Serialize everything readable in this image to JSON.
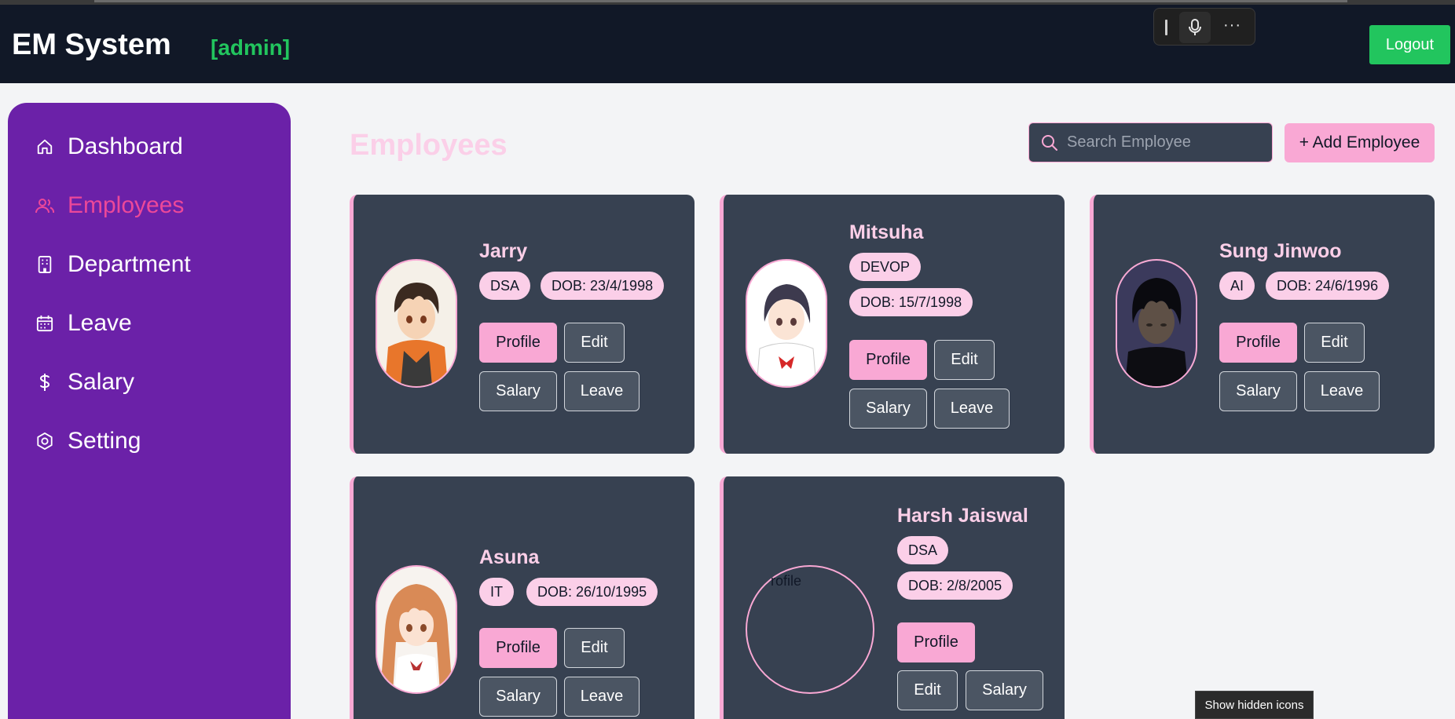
{
  "header": {
    "brand": "EM System",
    "role": "[admin]",
    "logout_label": "Logout"
  },
  "voice_toolbar": {
    "icons": [
      "text-cursor-icon",
      "microphone-icon",
      "more-icon"
    ],
    "more_glyph": "···"
  },
  "sidebar": {
    "items": [
      {
        "label": "Dashboard",
        "icon": "home-icon",
        "active": false
      },
      {
        "label": "Employees",
        "icon": "users-icon",
        "active": true
      },
      {
        "label": "Department",
        "icon": "building-icon",
        "active": false
      },
      {
        "label": "Leave",
        "icon": "calendar-icon",
        "active": false
      },
      {
        "label": "Salary",
        "icon": "dollar-icon",
        "active": false
      },
      {
        "label": "Setting",
        "icon": "settings-icon",
        "active": false
      }
    ]
  },
  "main": {
    "title": "Employees",
    "search_placeholder": "Search Employee",
    "add_label": "+ Add Employee"
  },
  "employees": [
    {
      "name": "Jarry",
      "department": "DSA",
      "dob": "DOB: 23/4/1998"
    },
    {
      "name": "Mitsuha",
      "department": "DEVOP",
      "dob": "DOB: 15/7/1998"
    },
    {
      "name": "Sung Jinwoo",
      "department": "AI",
      "dob": "DOB: 24/6/1996"
    },
    {
      "name": "Asuna",
      "department": "IT",
      "dob": "DOB: 26/10/1995"
    },
    {
      "name": "Harsh Jaiswal",
      "department": "DSA",
      "dob": "DOB: 2/8/2005",
      "avatar_alt": "rofile"
    }
  ],
  "actions": {
    "profile": "Profile",
    "edit": "Edit",
    "salary": "Salary",
    "leave": "Leave"
  },
  "tooltip": "Show hidden icons",
  "colors": {
    "header_bg": "#111827",
    "sidebar_bg": "#6b21a8",
    "accent_pink": "#f9a8d4",
    "active_nav": "#ec4899",
    "role_green": "#22c55e",
    "card_bg": "#374151"
  }
}
